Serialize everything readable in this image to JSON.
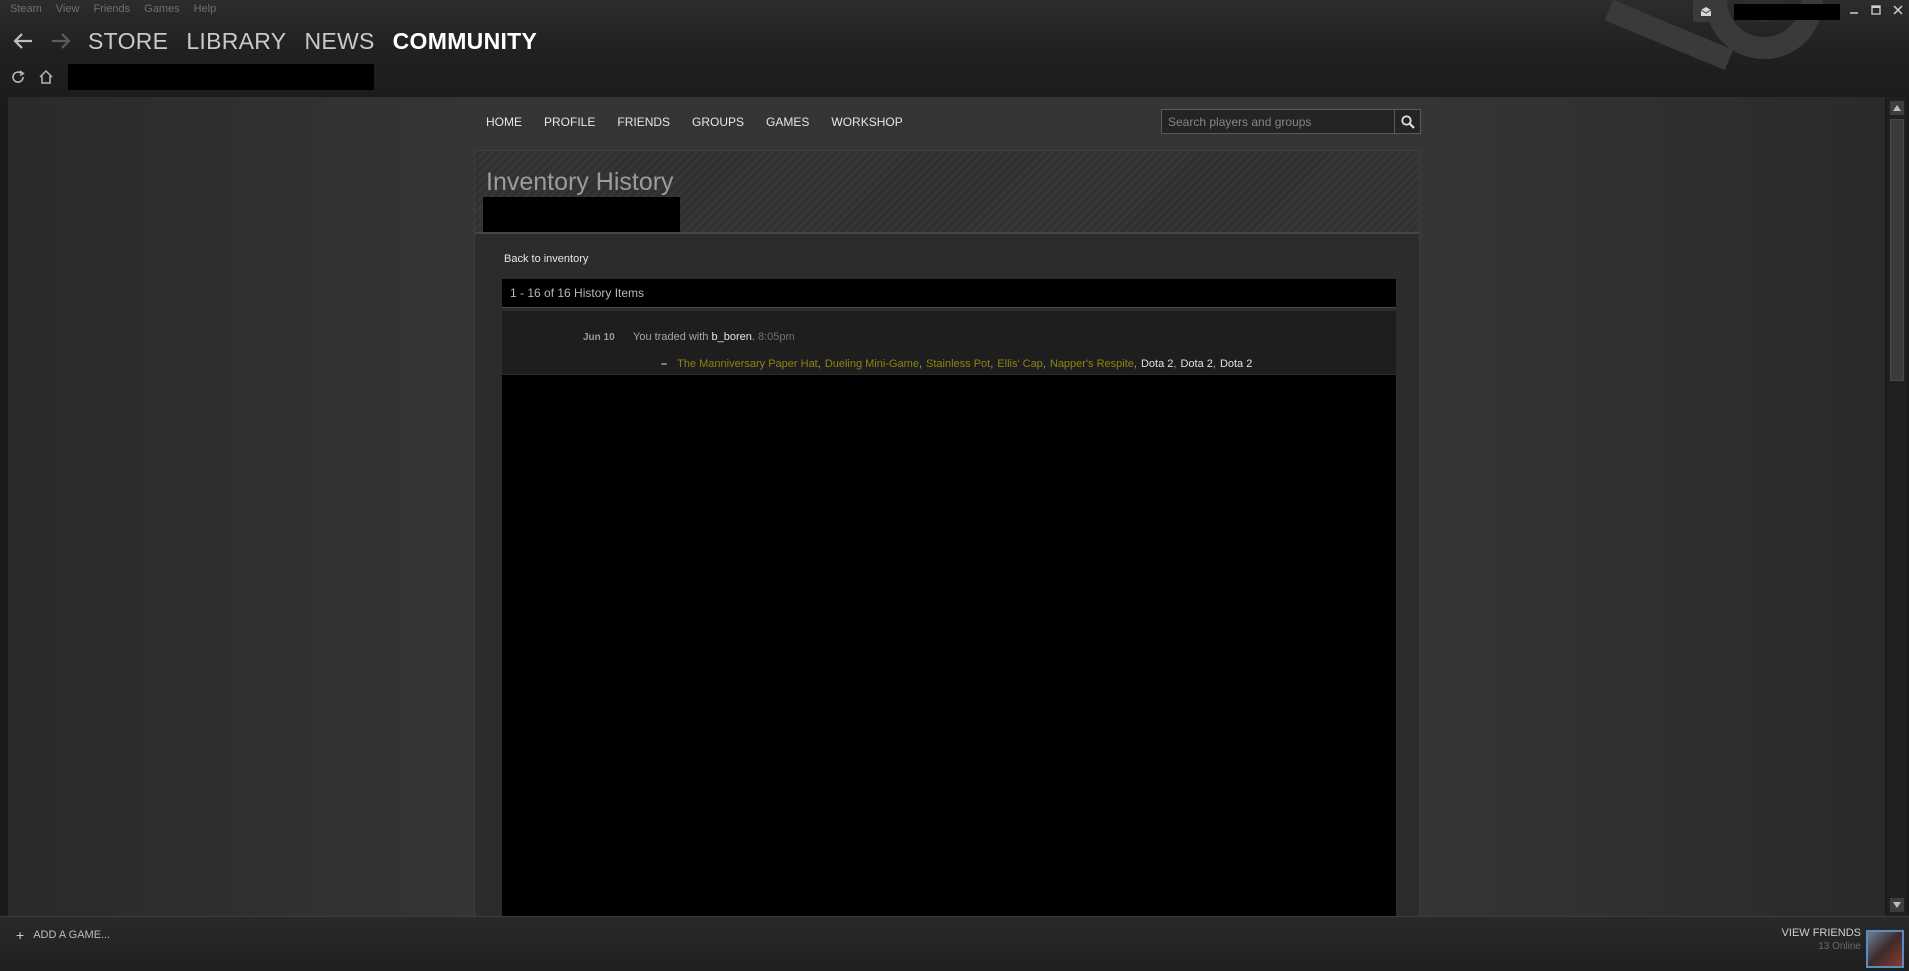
{
  "menubar": {
    "items": [
      "Steam",
      "View",
      "Friends",
      "Games",
      "Help"
    ]
  },
  "nav": {
    "tabs": [
      {
        "label": "STORE",
        "active": false
      },
      {
        "label": "LIBRARY",
        "active": false
      },
      {
        "label": "NEWS",
        "active": false
      },
      {
        "label": "COMMUNITY",
        "active": true
      }
    ]
  },
  "community_nav": {
    "items": [
      "HOME",
      "PROFILE",
      "FRIENDS",
      "GROUPS",
      "GAMES",
      "WORKSHOP"
    ]
  },
  "search": {
    "placeholder": "Search players and groups"
  },
  "page": {
    "title": "Inventory History",
    "back_link": "Back to inventory",
    "history_count": "1 - 16 of 16 History Items"
  },
  "history": [
    {
      "date": "Jun 10",
      "prefix": "You traded with",
      "user": "b_boren",
      "time": "8:05pm",
      "dash": "–",
      "items_gold": [
        "The Manniversary Paper Hat",
        "Dueling Mini-Game",
        "Stainless Pot",
        "Ellis' Cap",
        "Napper's Respite"
      ],
      "items_white": [
        "Dota 2",
        "Dota 2",
        "Dota 2"
      ]
    }
  ],
  "bottom": {
    "add_game": "ADD A GAME...",
    "view_friends": "VIEW FRIENDS",
    "online": "13 Online"
  },
  "colors": {
    "item_gold": "#8b8412",
    "accent_blue": "#5a8cc4"
  }
}
